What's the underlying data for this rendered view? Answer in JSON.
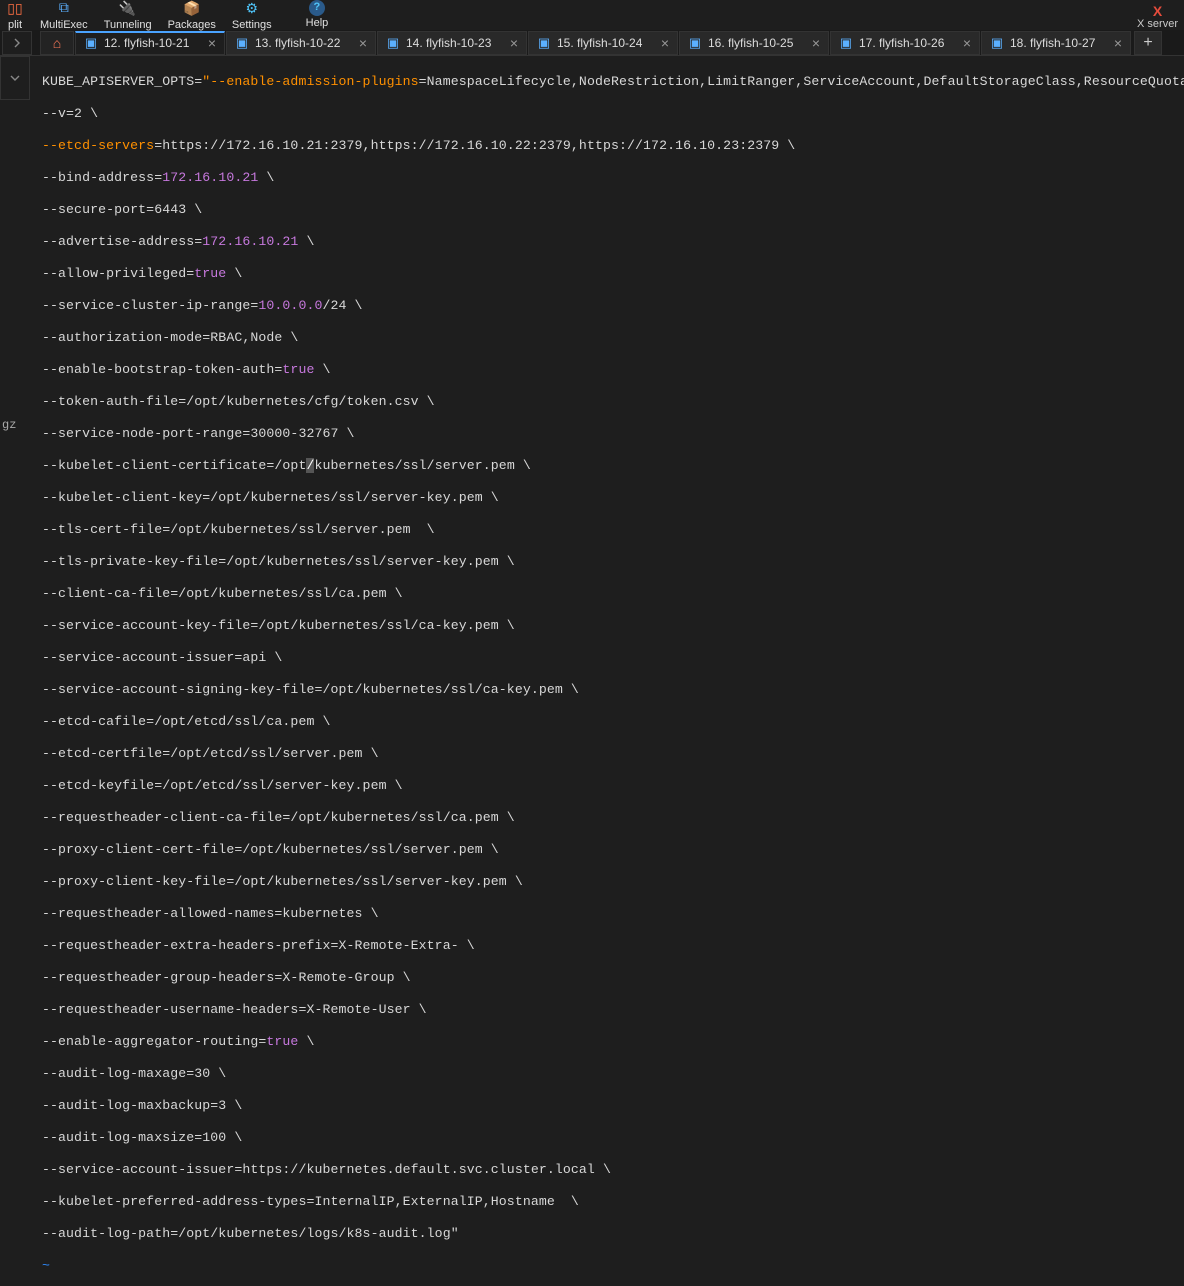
{
  "toolbar": {
    "items": [
      {
        "name": "split",
        "label": "plit",
        "icon": "▭"
      },
      {
        "name": "multiexec",
        "label": "MultiExec",
        "icon": "⧉"
      },
      {
        "name": "tunneling",
        "label": "Tunneling",
        "icon": "⚡"
      },
      {
        "name": "packages",
        "label": "Packages",
        "icon": "📦"
      },
      {
        "name": "settings",
        "label": "Settings",
        "icon": "⚙"
      },
      {
        "name": "help",
        "label": "Help",
        "icon": "?"
      }
    ]
  },
  "xserver": "X server",
  "tabs": [
    {
      "id": 12,
      "label": "12. flyfish-10-21",
      "active": true
    },
    {
      "id": 13,
      "label": "13. flyfish-10-22",
      "active": false
    },
    {
      "id": 14,
      "label": "14. flyfish-10-23",
      "active": false
    },
    {
      "id": 15,
      "label": "15. flyfish-10-24",
      "active": false
    },
    {
      "id": 16,
      "label": "16. flyfish-10-25",
      "active": false
    },
    {
      "id": 17,
      "label": "17. flyfish-10-26",
      "active": false
    },
    {
      "id": 18,
      "label": "18. flyfish-10-27",
      "active": false
    }
  ],
  "side_text": "gz",
  "config": {
    "var_name": "KUBE_APISERVER_OPTS",
    "flag_admission": "--enable-admission-plugins",
    "admission_value": "=NamespaceLifecycle,NodeRestriction,LimitRanger,ServiceAccount,DefaultStorageClass,ResourceQuota \\",
    "v": "--v=2 \\",
    "etcd_servers": "--etcd-servers",
    "etcd_servers_val": "=https://172.16.10.21:2379,https://172.16.10.22:2379,https://172.16.10.23:2379 \\",
    "bind_addr_key": "--bind-address=",
    "bind_addr_val": "172.16.10.21",
    "secure_port": "--secure-port=6443 \\",
    "advertise_key": "--advertise-address=",
    "advertise_val": "172.16.10.21",
    "allow_priv_key": "--allow-privileged=",
    "svc_ip_key": "--service-cluster-ip-range=",
    "svc_ip_val": "10.0.0.0",
    "svc_ip_suffix": "/24 \\",
    "authz": "--authorization-mode=RBAC,Node \\",
    "bootstrap_key": "--enable-bootstrap-token-auth=",
    "token_file": "--token-auth-file=/opt/kubernetes/cfg/token.csv \\",
    "nodeport": "--service-node-port-range=30000-32767 \\",
    "kubelet_cert_pre": "--kubelet-client-certificate=/opt",
    "kubelet_cert_hl": "/",
    "kubelet_cert_post": "kubernetes/ssl/server.pem \\",
    "kubelet_key": "--kubelet-client-key=/opt/kubernetes/ssl/server-key.pem \\",
    "tls_cert": "--tls-cert-file=/opt/kubernetes/ssl/server.pem  \\",
    "tls_key": "--tls-private-key-file=/opt/kubernetes/ssl/server-key.pem \\",
    "client_ca": "--client-ca-file=/opt/kubernetes/ssl/ca.pem \\",
    "sa_key": "--service-account-key-file=/opt/kubernetes/ssl/ca-key.pem \\",
    "sa_issuer": "--service-account-issuer=api \\",
    "sa_sign": "--service-account-signing-key-file=/opt/kubernetes/ssl/ca-key.pem \\",
    "etcd_ca": "--etcd-cafile=/opt/etcd/ssl/ca.pem \\",
    "etcd_cert": "--etcd-certfile=/opt/etcd/ssl/server.pem \\",
    "etcd_key": "--etcd-keyfile=/opt/etcd/ssl/server-key.pem \\",
    "req_ca": "--requestheader-client-ca-file=/opt/kubernetes/ssl/ca.pem \\",
    "proxy_cert": "--proxy-client-cert-file=/opt/kubernetes/ssl/server.pem \\",
    "proxy_key": "--proxy-client-key-file=/opt/kubernetes/ssl/server-key.pem \\",
    "req_allowed": "--requestheader-allowed-names=kubernetes \\",
    "req_extra": "--requestheader-extra-headers-prefix=X-Remote-Extra- \\",
    "req_group": "--requestheader-group-headers=X-Remote-Group \\",
    "req_user": "--requestheader-username-headers=X-Remote-User \\",
    "agg_key": "--enable-aggregator-routing=",
    "audit_age": "--audit-log-maxage=30 \\",
    "audit_backup": "--audit-log-maxbackup=3 \\",
    "audit_size": "--audit-log-maxsize=100 \\",
    "sa_issuer2": "--service-account-issuer=https://kubernetes.default.svc.cluster.local \\",
    "kubelet_addr": "--kubelet-preferred-address-types=InternalIP,ExternalIP,Hostname  \\",
    "audit_path": "--audit-log-path=/opt/kubernetes/logs/k8s-audit.log\"",
    "true_lit": "true",
    "bs": " \\",
    "tilde": "~"
  }
}
